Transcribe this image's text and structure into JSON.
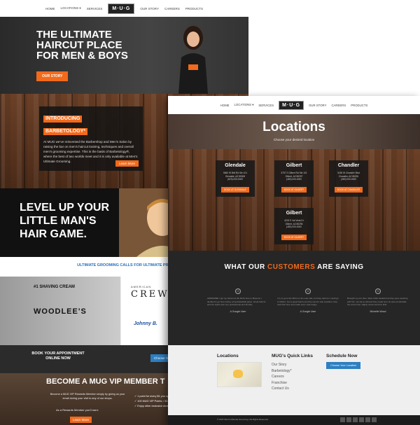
{
  "back_page": {
    "nav": {
      "items_left": [
        "HOME",
        "LOCATIONS ▾",
        "SERVICES"
      ],
      "logo": "M·U·G",
      "items_right": [
        "OUR STORY",
        "CAREERS",
        "PRODUCTS"
      ]
    },
    "hero": {
      "headline": "THE ULTIMATE HAIRCUT PLACE FOR MEN & BOYS",
      "button": "OUR STORY"
    },
    "intro": {
      "title_line1": "INTRODUCING",
      "title_line2": "BARBETOLOGY*",
      "body": "At MUG we've reinvented the Barbershop and Men's Salon by raising the bar on men's haircut training, techniques and overall men's grooming expertise. This is the basis of Barbetology®, where the best of two worlds meet and it is only available at Men's Ultimate Grooming.",
      "button": "Learn More"
    },
    "little": {
      "headline": "LEVEL UP YOUR LITTLE MAN'S HAIR GAME."
    },
    "calls": "ULTIMATE GROOMING CALLS FOR ULTIMATE PRO",
    "brands": {
      "shaving_tag": "#1 SHAVING CREAM",
      "woodlees": "WOODLEE'S",
      "crew_top": "AMERICAN",
      "crew": "CREW",
      "johnnyb": "Johnny B."
    },
    "booking": {
      "text": "BOOK YOUR APPOINTMENT ONLINE NOW",
      "button": "Choose Yo"
    },
    "vip": {
      "headline": "BECOME A MUG VIP MEMBER T",
      "desc": "Become a MUG VIP Rewards Member simply by giving us your email during your visit to any of our shops.",
      "rewards": "As a Rewards Member you'll earn:",
      "button": "Learn More",
      "perks": [
        "1 point for every $1 you sp",
        "100 MUG VIP Points = $10 off",
        "Enjoy other exclusive deals for MUG VIP Members!"
      ]
    }
  },
  "front_page": {
    "nav": {
      "items_left": [
        "HOME",
        "LOCATIONS ▾",
        "SERVICES"
      ],
      "logo": "M·U·G",
      "items_right": [
        "OUR STORY",
        "CAREERS",
        "PRODUCTS"
      ]
    },
    "banner": {
      "title": "Locations",
      "subtitle": "Choose your desired location"
    },
    "locations": [
      {
        "name": "Glendale",
        "address": "5660 W Bell Rd Ste 101\nGlendale, AZ 85308\n(623) 000-0000",
        "button": "BOOK AT GLENDALE"
      },
      {
        "name": "Gilbert",
        "address": "3757 S Gilbert Rd Ste 101\nGilbert, AZ 85297\n(480) 000-0000",
        "button": "BOOK AT GILBERT"
      },
      {
        "name": "Chandler",
        "address": "3155 W Chandler Blvd\nChandler, AZ 85226\n(480) 000-0000",
        "button": "BOOK AT CHANDLER"
      },
      {
        "name": "Gilbert",
        "address": "4232 E Val Vista Dr\nGilbert, AZ 85296\n(480) 000-0000",
        "button": "BOOK AT GILBERT"
      }
    ],
    "testimonials": {
      "heading_prefix": "WHAT OUR",
      "heading_accent": "CUSTOMERS",
      "heading_suffix": "ARE SAYING",
      "items": [
        {
          "quote": "AWESOME! I got my haircut at the MUG here in Mesa so I decided to go here before a big basketball game. Great haircut and the stylist was very professional and friendly.",
          "author": "A Google User"
        },
        {
          "quote": "I try to go to the MUG on the east side, but they told me I could go to Gilbert. Got a great haircut and the service was excellent, they took their time and made sure I was happy.",
          "author": "A Google User"
        },
        {
          "quote": "Brought my son here. Was a little hesitant but they were amazing with him. He sat so still and they made sure he was comfortable the entire time. Highly recommend for kids.",
          "author": "Michelle Wood"
        }
      ]
    },
    "footer": {
      "locations_heading": "Locations",
      "links_heading": "MUG's Quick Links",
      "links": [
        "Our Story",
        "Barbetology*",
        "Careers",
        "Franchise",
        "Contact Us"
      ],
      "schedule_heading": "Schedule Now",
      "schedule_button": "Choose Your Location",
      "copyright": "© 2017 Men's Ultimate Grooming  |  All Rights Reserved"
    }
  }
}
